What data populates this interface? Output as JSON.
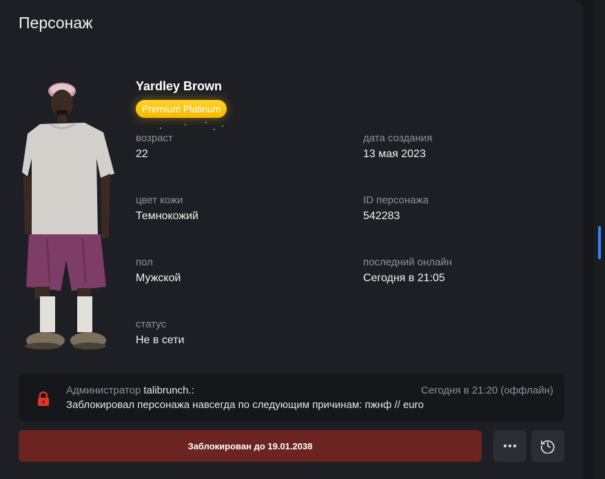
{
  "header": {
    "title": "Персонаж"
  },
  "character": {
    "name": "Yardley Brown",
    "badge": "Premium Platinum",
    "fields": {
      "age_label": "возраст",
      "age_value": "22",
      "created_label": "дата создания",
      "created_value": "13 мая 2023",
      "skin_label": "цвет кожи",
      "skin_value": "Темнокожий",
      "id_label": "ID персонажа",
      "id_value": "542283",
      "sex_label": "пол",
      "sex_value": "Мужской",
      "last_online_label": "последний онлайн",
      "last_online_value": "Сегодня в 21:05",
      "status_label": "статус",
      "status_value": "Не в сети"
    }
  },
  "ban_log": {
    "icon": "lock-icon",
    "role": "Администратор",
    "admin_nick": "talibrunch.:",
    "time": "Сегодня в 21:20 (оффлайн)",
    "text": "Заблокировал персонажа навсегда по следующим причинам: пжнф // euro"
  },
  "actions": {
    "blocked_label": "Заблокирован до 19.01.2038",
    "more_icon": "more-dots-icon",
    "history_icon": "history-clock-icon"
  },
  "colors": {
    "badge": "#f6b800",
    "blocked_button": "#6b241f",
    "lock": "#e0342a",
    "accent_scroll": "#3a82f0"
  }
}
